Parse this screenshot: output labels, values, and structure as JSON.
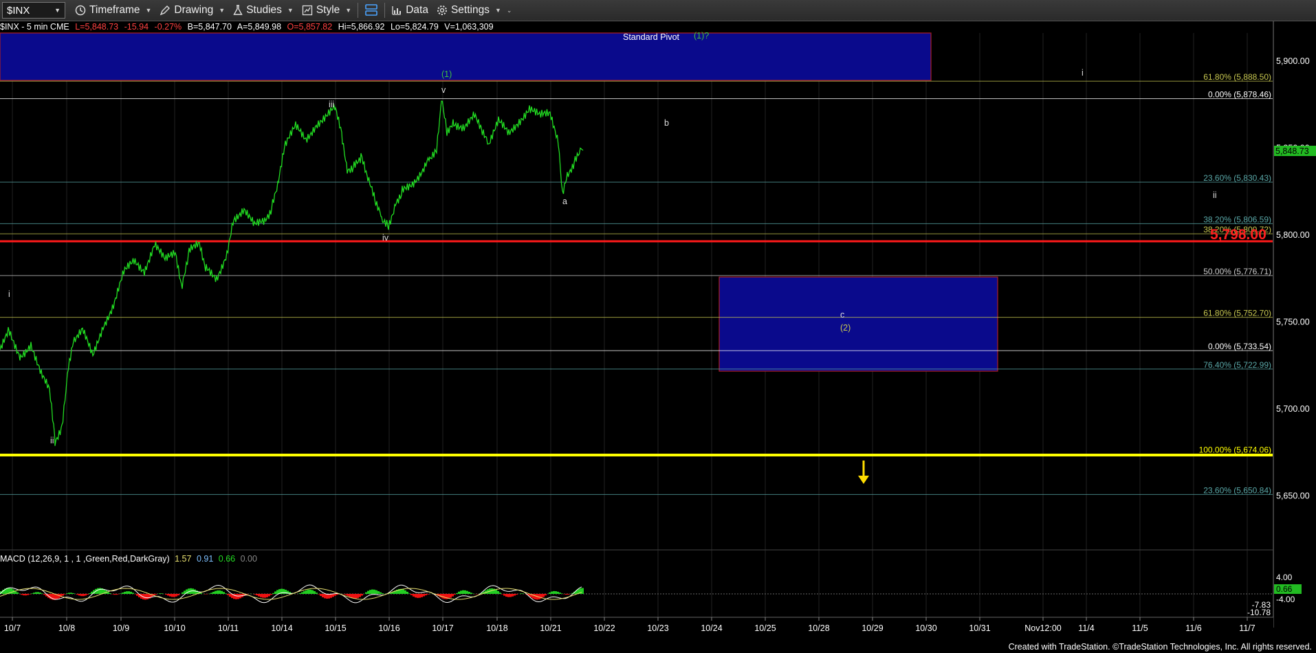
{
  "toolbar": {
    "symbol": "$INX",
    "timeframe": "Timeframe",
    "drawing": "Drawing",
    "studies": "Studies",
    "style": "Style",
    "data": "Data",
    "settings": "Settings"
  },
  "readout": {
    "instrument": "$INX - 5 min  CME",
    "last": "L=5,848.73",
    "change": "-15.94",
    "pct": "-0.27%",
    "bid": "B=5,847.70",
    "ask": "A=5,849.98",
    "open": "O=5,857.82",
    "high": "Hi=5,866.92",
    "low": "Lo=5,824.79",
    "volume": "V=1,063,309"
  },
  "macd": {
    "label": "MACD (12,26,9, 1 , 1 ,Green,Red,DarkGray)",
    "v1": "1.57",
    "v2": "0.91",
    "v3": "0.66",
    "v4": "0.00",
    "axis": [
      "4.00",
      "-4.00",
      "-7.83",
      "-10.78"
    ],
    "current": "0.66"
  },
  "price_axis": [
    "5,900.00",
    "5,850.00",
    "5,800.00",
    "5,750.00",
    "5,700.00",
    "5,650.00"
  ],
  "current_price_tag": "5,848.73",
  "big_level_tag": "5,798.00",
  "date_axis": [
    "10/7",
    "10/8",
    "10/9",
    "10/10",
    "10/11",
    "10/14",
    "10/15",
    "10/16",
    "10/17",
    "10/18",
    "10/21",
    "10/22",
    "10/23",
    "10/24",
    "10/25",
    "10/28",
    "10/29",
    "10/30",
    "10/31",
    "Nov12:00",
    "11/4",
    "11/5",
    "11/6",
    "11/7"
  ],
  "fib_levels": [
    {
      "text": "61.80% (5,888.50)",
      "price": 5888.5,
      "color": "#c8c850"
    },
    {
      "text": "0.00% (5,878.46)",
      "price": 5878.46,
      "color": "#ffffff"
    },
    {
      "text": "23.60% (5,830.43)",
      "price": 5830.43,
      "color": "#5aa8a8"
    },
    {
      "text": "38.20% (5,806.59)",
      "price": 5806.59,
      "color": "#5aa8a8"
    },
    {
      "text": "38.20% (5,800.72)",
      "price": 5800.72,
      "color": "#c8c850"
    },
    {
      "text": "50.00% (5,776.71)",
      "price": 5776.71,
      "color": "#cccccc"
    },
    {
      "text": "61.80% (5,752.70)",
      "price": 5752.7,
      "color": "#c8c850"
    },
    {
      "text": "0.00% (5,733.54)",
      "price": 5733.54,
      "color": "#ffffff"
    },
    {
      "text": "76.40% (5,722.99)",
      "price": 5722.99,
      "color": "#5aa8a8"
    },
    {
      "text": "100.00% (5,674.06)",
      "price": 5674.06,
      "color": "#ffff00"
    },
    {
      "text": "23.60% (5,650.84)",
      "price": 5650.84,
      "color": "#5aa8a8"
    }
  ],
  "pivot": {
    "label": "Standard Pivot",
    "tag": "(1)?"
  },
  "wave_labels": {
    "i_left": "i",
    "ii": "ii",
    "iii": "iii",
    "iv": "iv",
    "v": "v",
    "w1": "(1)",
    "a": "a",
    "b": "b",
    "c": "c",
    "w2": "(2)",
    "i_right": "i",
    "ii_right": "ii"
  },
  "footer": "Created with TradeStation. ©TradeStation Technologies, Inc. All rights reserved."
}
